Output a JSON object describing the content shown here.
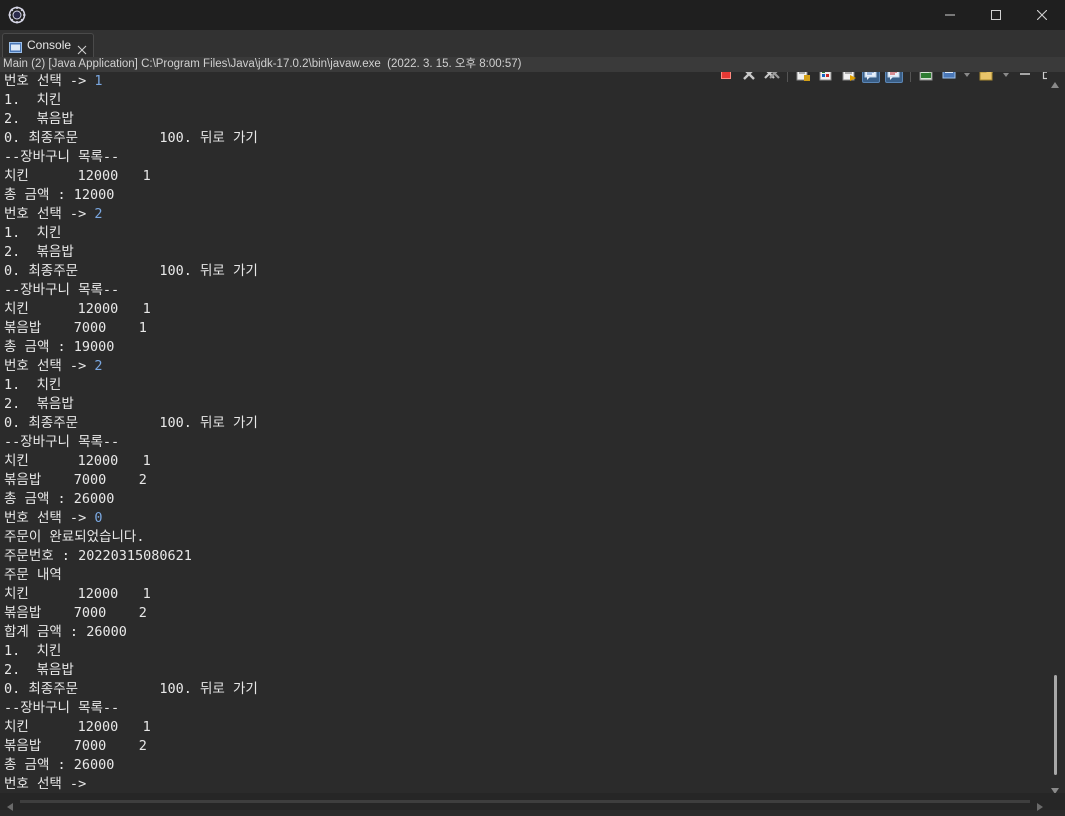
{
  "window": {
    "minimize_label": "—",
    "maximize_label": "☐",
    "close_label": "✕"
  },
  "tab": {
    "label": "Console"
  },
  "status_line": "Main (2) [Java Application] C:\\Program Files\\Java\\jdk-17.0.2\\bin\\javaw.exe  (2022. 3. 15. 오후 8:00:57)",
  "console_lines": [
    {
      "text": "번호 선택 -> ",
      "input": "1"
    },
    {
      "text": "1.  치킨",
      "input": ""
    },
    {
      "text": "2.  볶음밥",
      "input": ""
    },
    {
      "text": "0. 최종주문          100. 뒤로 가기",
      "input": ""
    },
    {
      "text": "--장바구니 목록--",
      "input": ""
    },
    {
      "text": "치킨      12000   1",
      "input": ""
    },
    {
      "text": "총 금액 : 12000",
      "input": ""
    },
    {
      "text": "번호 선택 -> ",
      "input": "2"
    },
    {
      "text": "1.  치킨",
      "input": ""
    },
    {
      "text": "2.  볶음밥",
      "input": ""
    },
    {
      "text": "0. 최종주문          100. 뒤로 가기",
      "input": ""
    },
    {
      "text": "--장바구니 목록--",
      "input": ""
    },
    {
      "text": "치킨      12000   1",
      "input": ""
    },
    {
      "text": "볶음밥    7000    1",
      "input": ""
    },
    {
      "text": "총 금액 : 19000",
      "input": ""
    },
    {
      "text": "번호 선택 -> ",
      "input": "2"
    },
    {
      "text": "1.  치킨",
      "input": ""
    },
    {
      "text": "2.  볶음밥",
      "input": ""
    },
    {
      "text": "0. 최종주문          100. 뒤로 가기",
      "input": ""
    },
    {
      "text": "--장바구니 목록--",
      "input": ""
    },
    {
      "text": "치킨      12000   1",
      "input": ""
    },
    {
      "text": "볶음밥    7000    2",
      "input": ""
    },
    {
      "text": "총 금액 : 26000",
      "input": ""
    },
    {
      "text": "번호 선택 -> ",
      "input": "0"
    },
    {
      "text": "주문이 완료되었습니다.",
      "input": ""
    },
    {
      "text": "주문번호 : 20220315080621",
      "input": ""
    },
    {
      "text": "주문 내역",
      "input": ""
    },
    {
      "text": "치킨      12000   1",
      "input": ""
    },
    {
      "text": "볶음밥    7000    2",
      "input": ""
    },
    {
      "text": "합계 금액 : 26000",
      "input": ""
    },
    {
      "text": "1.  치킨",
      "input": ""
    },
    {
      "text": "2.  볶음밥",
      "input": ""
    },
    {
      "text": "0. 최종주문          100. 뒤로 가기",
      "input": ""
    },
    {
      "text": "--장바구니 목록--",
      "input": ""
    },
    {
      "text": "치킨      12000   1",
      "input": ""
    },
    {
      "text": "볶음밥    7000    2",
      "input": ""
    },
    {
      "text": "총 금액 : 26000",
      "input": ""
    },
    {
      "text": "번호 선택 -> ",
      "input": ""
    }
  ],
  "colors": {
    "background": "#2b2b2b",
    "text": "#e8e8e8",
    "user_input": "#7aa7e0",
    "terminate": "#e53935"
  },
  "toolbar_icons": [
    "terminate-icon",
    "remove-launch-icon",
    "remove-all-terminated-icon",
    "scroll-lock-icon",
    "word-wrap-icon",
    "show-console-on-stdout-icon",
    "show-console-on-stderr-icon",
    "pin-console-icon",
    "display-selected-console-icon",
    "open-console-icon",
    "minimize-view-icon",
    "maximize-view-icon"
  ]
}
